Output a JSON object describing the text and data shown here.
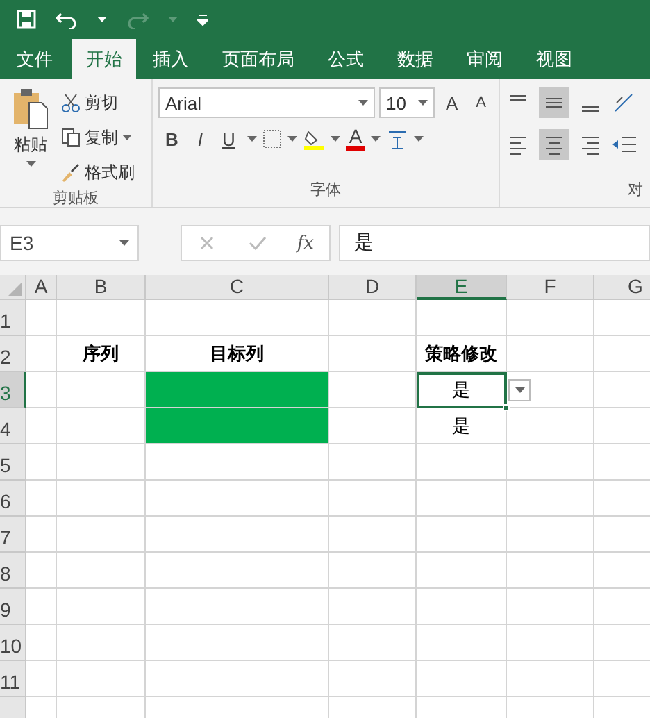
{
  "tabs": [
    {
      "label": "文件",
      "selected": false
    },
    {
      "label": "开始",
      "selected": true
    },
    {
      "label": "插入",
      "selected": false
    },
    {
      "label": "页面布局",
      "selected": false
    },
    {
      "label": "公式",
      "selected": false
    },
    {
      "label": "数据",
      "selected": false
    },
    {
      "label": "审阅",
      "selected": false
    },
    {
      "label": "视图",
      "selected": false
    }
  ],
  "clipboard": {
    "paste": "粘贴",
    "cut": "剪切",
    "copy": "复制",
    "format_painter": "格式刷",
    "label": "剪贴板"
  },
  "font": {
    "name": "Arial",
    "size": "10",
    "grow": "A",
    "shrink": "A",
    "bold": "B",
    "italic": "I",
    "underline": "U",
    "font_color": "A",
    "label": "字体"
  },
  "alignment": {
    "label": "对"
  },
  "formula_bar": {
    "name_box": "E3",
    "fx": "fx",
    "value": "是"
  },
  "sheet": {
    "dropdown": true,
    "columns": [
      {
        "label": "A",
        "selected": false
      },
      {
        "label": "B",
        "selected": false
      },
      {
        "label": "C",
        "selected": false,
        "color": "#00b050"
      },
      {
        "label": "D",
        "selected": false
      },
      {
        "label": "E",
        "selected": true
      },
      {
        "label": "F",
        "selected": false
      },
      {
        "label": "G",
        "selected": false
      }
    ],
    "rows": [
      {
        "label": "1",
        "selected": false
      },
      {
        "label": "2",
        "selected": false,
        "bold": true,
        "cells": {
          "B": "序列",
          "C": "目标列",
          "E": "策略修改"
        }
      },
      {
        "label": "3",
        "selected": true,
        "cells": {
          "E": "是"
        },
        "filled": true
      },
      {
        "label": "4",
        "selected": false,
        "cells": {
          "E": "是"
        },
        "filled": true
      },
      {
        "label": "5",
        "selected": false
      },
      {
        "label": "6",
        "selected": false
      },
      {
        "label": "7",
        "selected": false
      },
      {
        "label": "8",
        "selected": false
      },
      {
        "label": "9",
        "selected": false
      },
      {
        "label": "10",
        "selected": false
      },
      {
        "label": "11",
        "selected": false
      },
      {
        "selected": false
      }
    ]
  }
}
